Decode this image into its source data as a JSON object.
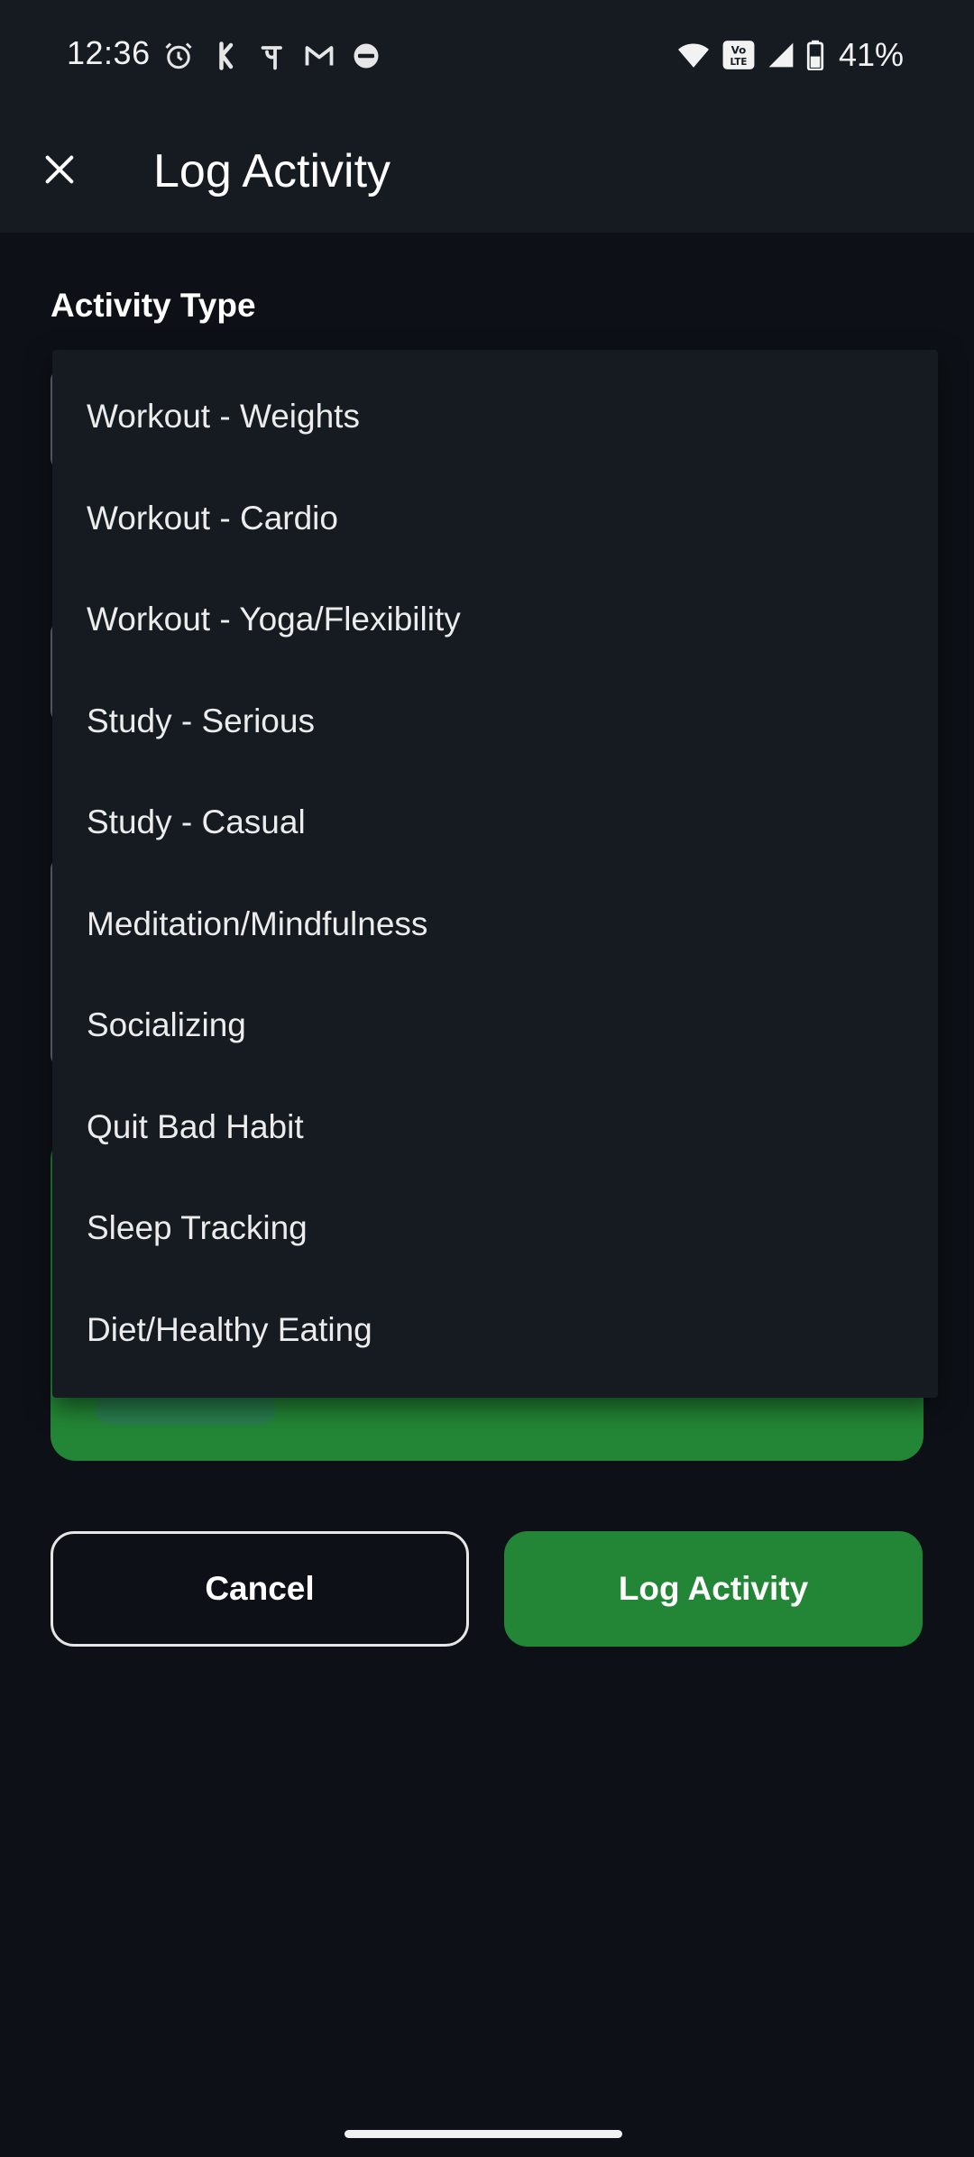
{
  "status_bar": {
    "time": "12:36",
    "battery": "41%",
    "icons_left": [
      "alarm-icon",
      "app-icon-k",
      "phonepe-icon",
      "gmail-icon",
      "wear-icon"
    ],
    "icons_right": [
      "wifi-icon",
      "volte-icon",
      "signal-icon",
      "battery-icon"
    ]
  },
  "app_bar": {
    "title": "Log Activity"
  },
  "form": {
    "activity_type_label": "Activity Type"
  },
  "dropdown": {
    "options": [
      "Workout - Weights",
      "Workout - Cardio",
      "Workout - Yoga/Flexibility",
      "Study - Serious",
      "Study - Casual",
      "Meditation/Mindfulness",
      "Socializing",
      "Quit Bad Habit",
      "Sleep Tracking",
      "Diet/Healthy Eating"
    ]
  },
  "actions": {
    "cancel_label": "Cancel",
    "log_label": "Log Activity"
  },
  "colors": {
    "background": "#0d1117",
    "surface": "#161b22",
    "accent_green": "#238636"
  }
}
